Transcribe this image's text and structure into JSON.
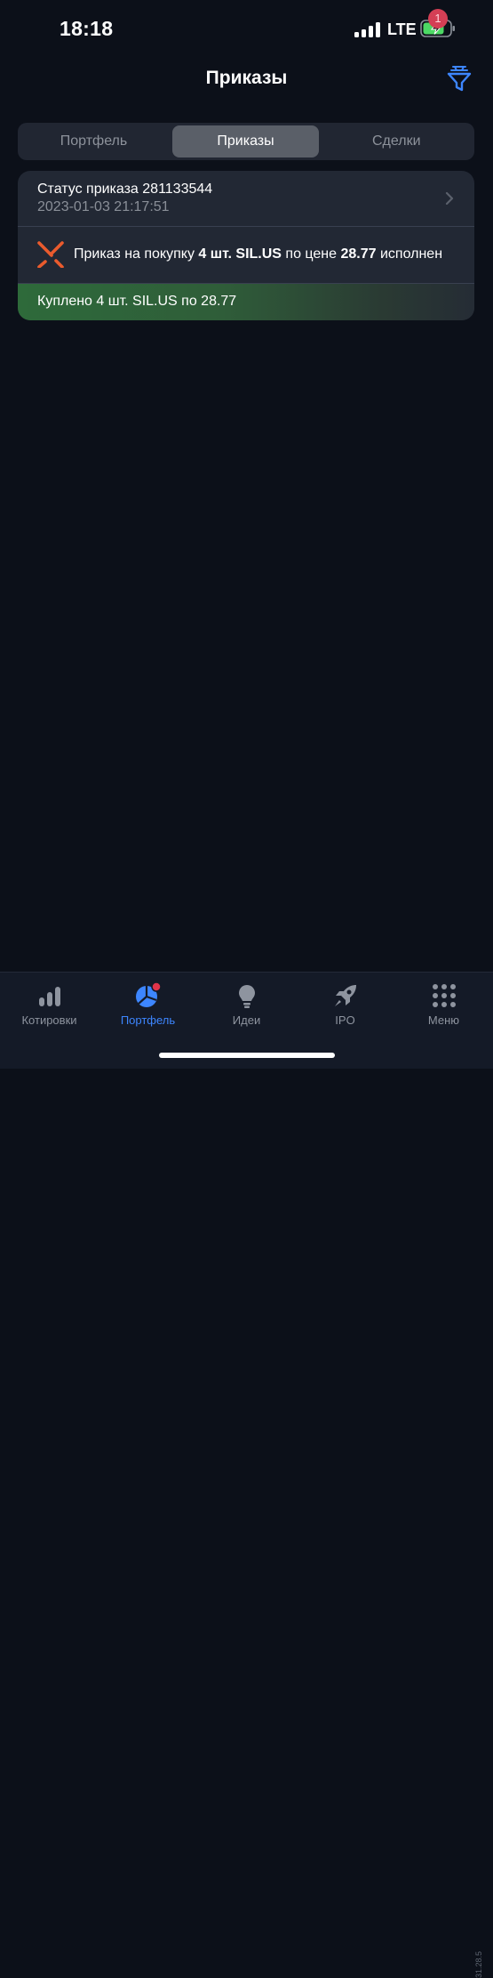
{
  "status_bar": {
    "time": "18:18",
    "network": "LTE"
  },
  "header": {
    "title": "Приказы",
    "filter_icon": "filter-icon",
    "accent_color": "#3d86ff"
  },
  "segments": {
    "items": [
      {
        "label": "Портфель",
        "selected": false
      },
      {
        "label": "Приказы",
        "selected": true
      },
      {
        "label": "Сделки",
        "selected": false,
        "badge": "1"
      }
    ]
  },
  "order": {
    "status_title": "Статус приказа 281133544",
    "datetime": "2023-01-03 21:17:51",
    "message": {
      "prefix": "Приказ на покупку ",
      "qty": "4 шт. SIL.US",
      "middle": " по цене ",
      "price": "28.77",
      "suffix": " исполнен"
    },
    "fill_text": "Куплено 4 шт. SIL.US по 28.77"
  },
  "tabbar": {
    "items": [
      {
        "label": "Котировки",
        "icon": "bar-chart-icon",
        "active": false
      },
      {
        "label": "Портфель",
        "icon": "pie-chart-icon",
        "active": true
      },
      {
        "label": "Идеи",
        "icon": "lightbulb-icon",
        "active": false
      },
      {
        "label": "IPO",
        "icon": "rocket-icon",
        "active": false
      },
      {
        "label": "Меню",
        "icon": "grid-dots-icon",
        "active": false
      }
    ]
  },
  "version": "31.28.5"
}
